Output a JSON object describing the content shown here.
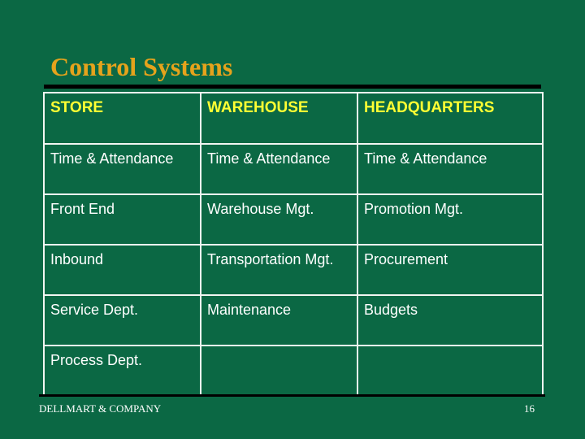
{
  "slide": {
    "title": "Control Systems",
    "footer_company": "DELLMART & COMPANY",
    "page_number": "16"
  },
  "colors": {
    "background": "#0b6844",
    "title": "#e5a31c",
    "header_text": "#ffff33",
    "body_text": "#ffffff"
  },
  "table": {
    "headers": [
      "STORE",
      "WAREHOUSE",
      "HEADQUARTERS"
    ],
    "rows": [
      [
        "Time & Attendance",
        "Time & Attendance",
        "Time & Attendance"
      ],
      [
        "Front End",
        "Warehouse Mgt.",
        "Promotion Mgt."
      ],
      [
        "Inbound",
        "Transportation Mgt.",
        "Procurement"
      ],
      [
        "Service Dept.",
        "Maintenance",
        "Budgets"
      ],
      [
        "Process Dept.",
        "",
        ""
      ]
    ]
  }
}
